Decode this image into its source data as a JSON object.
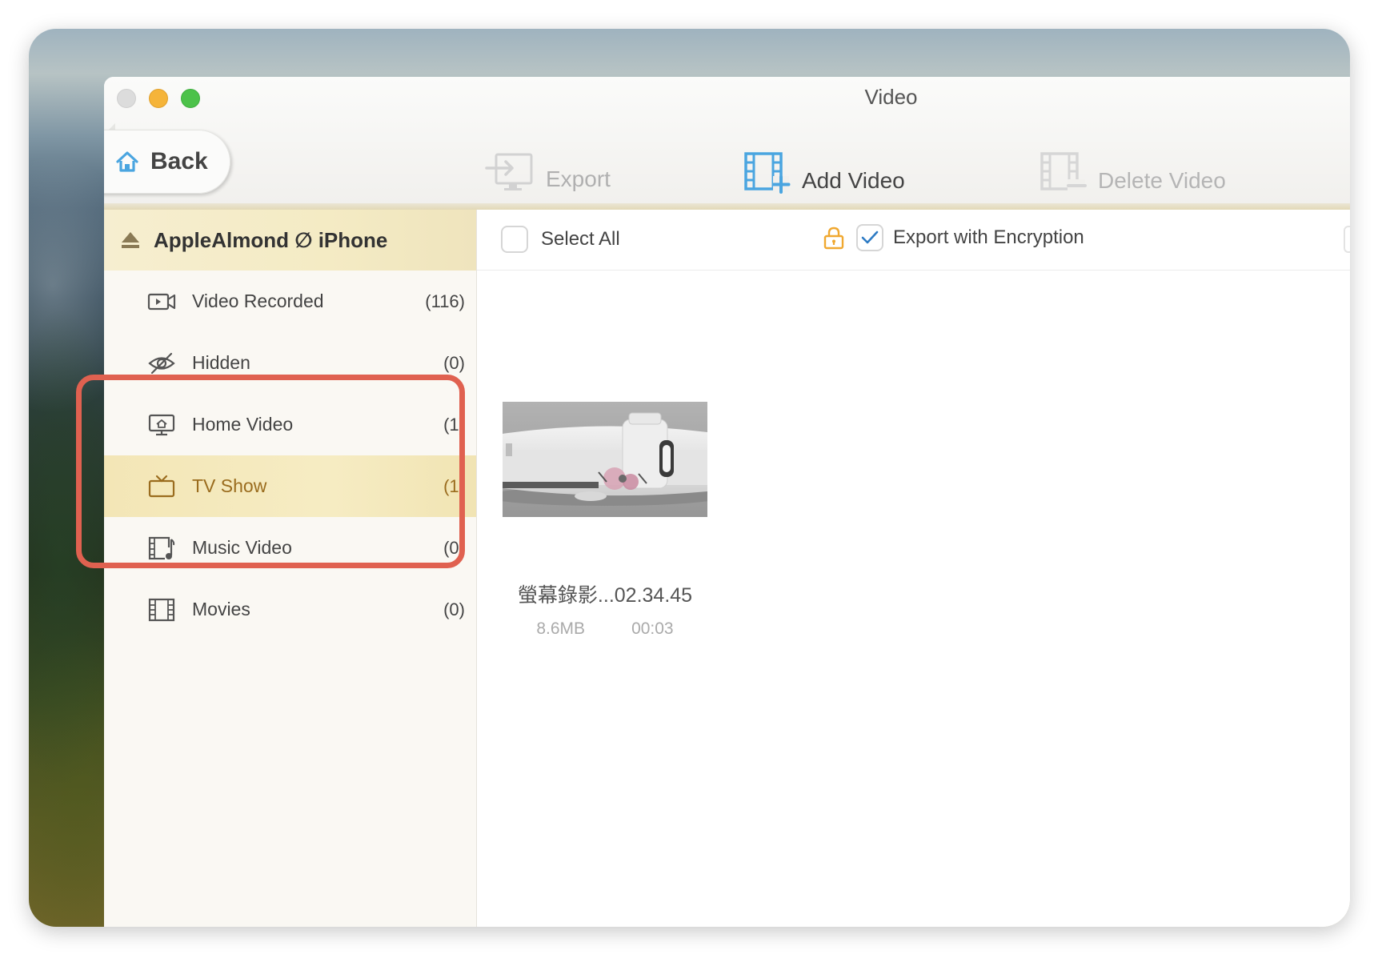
{
  "window": {
    "title": "Video"
  },
  "toolbar": {
    "back_label": "Back",
    "export_label": "Export",
    "add_video_label": "Add Video",
    "delete_video_label": "Delete Video"
  },
  "device": {
    "name": "AppleAlmond ∅ iPhone"
  },
  "sidebar": {
    "items": [
      {
        "label": "Video Recorded",
        "count": "(116)",
        "icon": "video-camera-icon"
      },
      {
        "label": "Hidden",
        "count": "(0)",
        "icon": "eye-slash-icon"
      },
      {
        "label": "Home Video",
        "count": "(1)",
        "icon": "home-screen-icon"
      },
      {
        "label": "TV Show",
        "count": "(1)",
        "icon": "tv-icon",
        "active": true
      },
      {
        "label": "Music Video",
        "count": "(0)",
        "icon": "music-film-icon"
      },
      {
        "label": "Movies",
        "count": "(0)",
        "icon": "film-strip-icon"
      }
    ]
  },
  "selection": {
    "select_all_label": "Select All",
    "export_encryption_label": "Export with Encryption",
    "export_encryption_checked": true
  },
  "videos": [
    {
      "name": "螢幕錄影...02.34.45",
      "size": "8.6MB",
      "duration": "00:03"
    }
  ],
  "colors": {
    "accent_blue": "#4aa5e0",
    "active_gold": "#9a6c1e",
    "highlight_red": "#e06150",
    "lock_orange": "#f0a830"
  }
}
